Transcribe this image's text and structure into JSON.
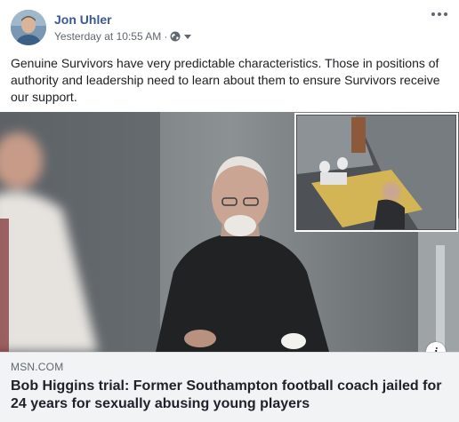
{
  "post": {
    "author": "Jon Uhler",
    "timestamp": "Yesterday at 10:55 AM",
    "separator": "·",
    "privacy_icon": "globe-icon",
    "text": "Genuine Survivors have very predictable characteristics. Those in positions of authority and leadership need to learn about them to ensure Survivors receive our support."
  },
  "link_preview": {
    "source": "MSN.COM",
    "headline": "Bob Higgins trial: Former Southampton football coach jailed for 24 years for sexually abusing young players"
  },
  "colors": {
    "author_link": "#385898",
    "link_box_bg": "#f2f3f5",
    "meta_text": "#606770"
  }
}
